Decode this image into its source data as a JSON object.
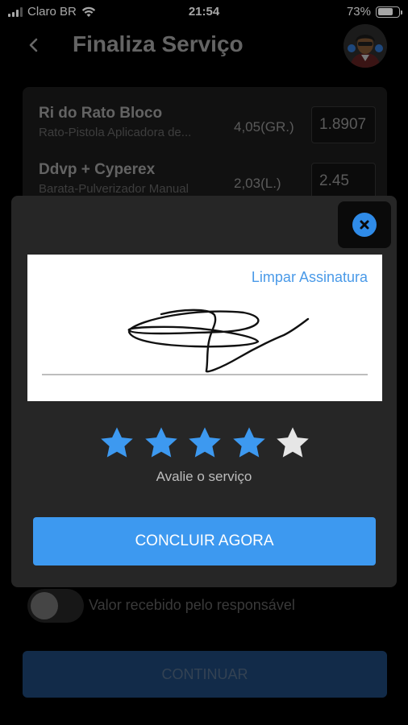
{
  "status_bar": {
    "carrier": "Claro BR",
    "time": "21:54",
    "battery": "73%",
    "battery_level": 0.73
  },
  "header": {
    "title": "Finaliza Serviço"
  },
  "products": [
    {
      "name": "Ri do Rato Bloco",
      "description": "Rato-Pistola Aplicadora de...",
      "quantity": "4,05(GR.)",
      "value": "1.8907"
    },
    {
      "name": "Ddvp + Cyperex",
      "description": "Barata-Pulverizador Manual",
      "quantity": "2,03(L.)",
      "value": "2.45"
    }
  ],
  "modal": {
    "clear_signature_label": "Limpar Assinatura",
    "rating": {
      "value": 4,
      "max": 5
    },
    "rating_label": "Avalie o serviço",
    "conclude_label": "CONCLUIR AGORA"
  },
  "received_toggle": {
    "label": "Valor recebido pelo responsável",
    "on": false
  },
  "continue_label": "CONTINUAR",
  "colors": {
    "accent": "#3d99f0",
    "star_filled": "#3d99f0",
    "star_empty": "#e6e6e6"
  },
  "icons": {
    "back": "chevron-left-icon",
    "close": "close-circle-icon",
    "star": "star-icon",
    "avatar": "user-avatar"
  }
}
